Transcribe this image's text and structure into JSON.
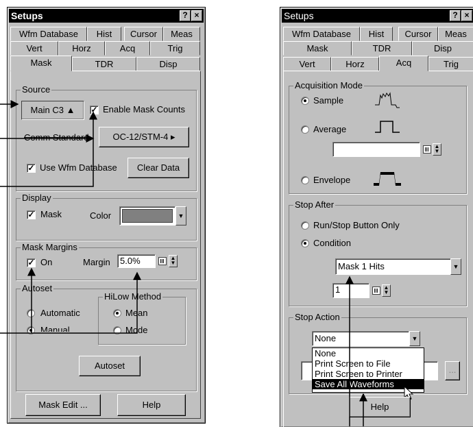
{
  "left_dialog": {
    "title": "Setups",
    "title_buttons": [
      "?",
      "×"
    ],
    "tabs_row1": [
      "Wfm Database",
      "Hist",
      "Cursor",
      "Meas"
    ],
    "tabs_row2": [
      "Vert",
      "Horz",
      "Acq",
      "Trig"
    ],
    "tabs_row3": [
      "Mask",
      "TDR",
      "Disp"
    ],
    "selected_tab": "Mask",
    "source": {
      "group_label": "Source",
      "source_button": "Main C3 ▲",
      "enable_mask_counts": "Enable Mask Counts",
      "comm_standard": "Comm Standard",
      "standard_button": "OC-12/STM-4 ▸",
      "use_wfm_database": "Use Wfm Database",
      "clear_data": "Clear Data"
    },
    "display": {
      "group_label": "Display",
      "mask": "Mask",
      "color": "Color",
      "color_value": "#808080"
    },
    "mask_margins": {
      "group_label": "Mask Margins",
      "on": "On",
      "margin_label": "Margin",
      "margin_value": "5.0%"
    },
    "autoset": {
      "group_label": "Autoset",
      "automatic": "Automatic",
      "manual": "Manual",
      "hilow_label": "HiLow Method",
      "mean": "Mean",
      "mode": "Mode",
      "autoset_button": "Autoset"
    },
    "mask_edit_button": "Mask Edit ...",
    "help_button": "Help"
  },
  "right_dialog": {
    "title": "Setups",
    "title_buttons": [
      "?",
      "×"
    ],
    "tabs_row1": [
      "Wfm Database",
      "Hist",
      "Cursor",
      "Meas"
    ],
    "tabs_row2": [
      "Mask",
      "TDR",
      "Disp"
    ],
    "tabs_row3": [
      "Vert",
      "Horz",
      "Acq",
      "Trig"
    ],
    "selected_tab": "Acq",
    "acq_mode": {
      "group_label": "Acquisition Mode",
      "sample": "Sample",
      "average": "Average",
      "envelope": "Envelope"
    },
    "stop_after": {
      "group_label": "Stop After",
      "run_stop": "Run/Stop Button Only",
      "condition": "Condition",
      "condition_value": "Mask 1 Hits",
      "count_value": "1"
    },
    "stop_action": {
      "group_label": "Stop Action",
      "value": "None",
      "options": [
        "None",
        "Print Screen to File",
        "Print Screen to Printer",
        "Save All Waveforms"
      ],
      "highlighted": "Save All Waveforms",
      "more_button": "..."
    },
    "help_button": "Help"
  }
}
